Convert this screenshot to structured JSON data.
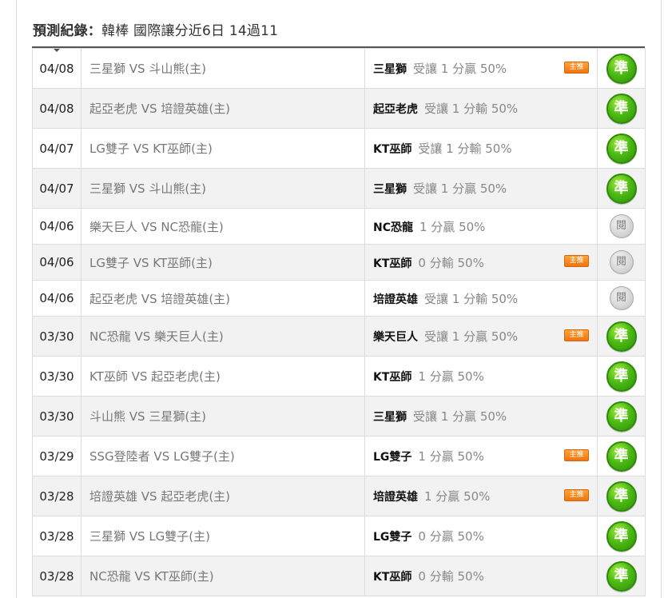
{
  "header": {
    "label": "預測紀錄：",
    "summary": "韓棒 國際讓分近6日 14過11"
  },
  "colors": {
    "hit": "#4dbb14",
    "draw": "#c8c8c8",
    "badge": "#f08a1e"
  },
  "records": [
    {
      "date": "04/08",
      "match": "三星獅 VS 斗山熊(主)",
      "pick_team": "三星獅",
      "pick_detail": "受讓 1 分贏 50%",
      "badge": "主推",
      "result": "準",
      "result_type": "hit"
    },
    {
      "date": "04/08",
      "match": "起亞老虎 VS 培證英雄(主)",
      "pick_team": "起亞老虎",
      "pick_detail": "受讓 1 分輸 50%",
      "badge": "",
      "result": "準",
      "result_type": "hit"
    },
    {
      "date": "04/07",
      "match": "LG雙子 VS KT巫師(主)",
      "pick_team": "KT巫師",
      "pick_detail": "受讓 1 分輸 50%",
      "badge": "",
      "result": "準",
      "result_type": "hit"
    },
    {
      "date": "04/07",
      "match": "三星獅 VS 斗山熊(主)",
      "pick_team": "三星獅",
      "pick_detail": "受讓 1 分贏 50%",
      "badge": "",
      "result": "準",
      "result_type": "hit"
    },
    {
      "date": "04/06",
      "match": "樂天巨人 VS NC恐龍(主)",
      "pick_team": "NC恐龍",
      "pick_detail": "1 分贏 50%",
      "badge": "",
      "result": "閱",
      "result_type": "draw"
    },
    {
      "date": "04/06",
      "match": "LG雙子 VS KT巫師(主)",
      "pick_team": "KT巫師",
      "pick_detail": "0 分輸 50%",
      "badge": "主推",
      "result": "閱",
      "result_type": "draw"
    },
    {
      "date": "04/06",
      "match": "起亞老虎 VS 培證英雄(主)",
      "pick_team": "培證英雄",
      "pick_detail": "受讓 1 分輸 50%",
      "badge": "",
      "result": "閱",
      "result_type": "draw"
    },
    {
      "date": "03/30",
      "match": "NC恐龍 VS 樂天巨人(主)",
      "pick_team": "樂天巨人",
      "pick_detail": "受讓 1 分贏 50%",
      "badge": "主推",
      "result": "準",
      "result_type": "hit"
    },
    {
      "date": "03/30",
      "match": "KT巫師 VS 起亞老虎(主)",
      "pick_team": "KT巫師",
      "pick_detail": "1 分贏 50%",
      "badge": "",
      "result": "準",
      "result_type": "hit"
    },
    {
      "date": "03/30",
      "match": "斗山熊 VS 三星獅(主)",
      "pick_team": "三星獅",
      "pick_detail": "受讓 1 分贏 50%",
      "badge": "",
      "result": "準",
      "result_type": "hit"
    },
    {
      "date": "03/29",
      "match": "SSG登陸者 VS LG雙子(主)",
      "pick_team": "LG雙子",
      "pick_detail": "1 分贏 50%",
      "badge": "主推",
      "result": "準",
      "result_type": "hit"
    },
    {
      "date": "03/28",
      "match": "培證英雄 VS 起亞老虎(主)",
      "pick_team": "培證英雄",
      "pick_detail": "1 分贏 50%",
      "badge": "主推",
      "result": "準",
      "result_type": "hit"
    },
    {
      "date": "03/28",
      "match": "三星獅 VS LG雙子(主)",
      "pick_team": "LG雙子",
      "pick_detail": "0 分贏 50%",
      "badge": "",
      "result": "準",
      "result_type": "hit"
    },
    {
      "date": "03/28",
      "match": "NC恐龍 VS KT巫師(主)",
      "pick_team": "KT巫師",
      "pick_detail": "0 分輸 50%",
      "badge": "",
      "result": "準",
      "result_type": "hit"
    }
  ]
}
